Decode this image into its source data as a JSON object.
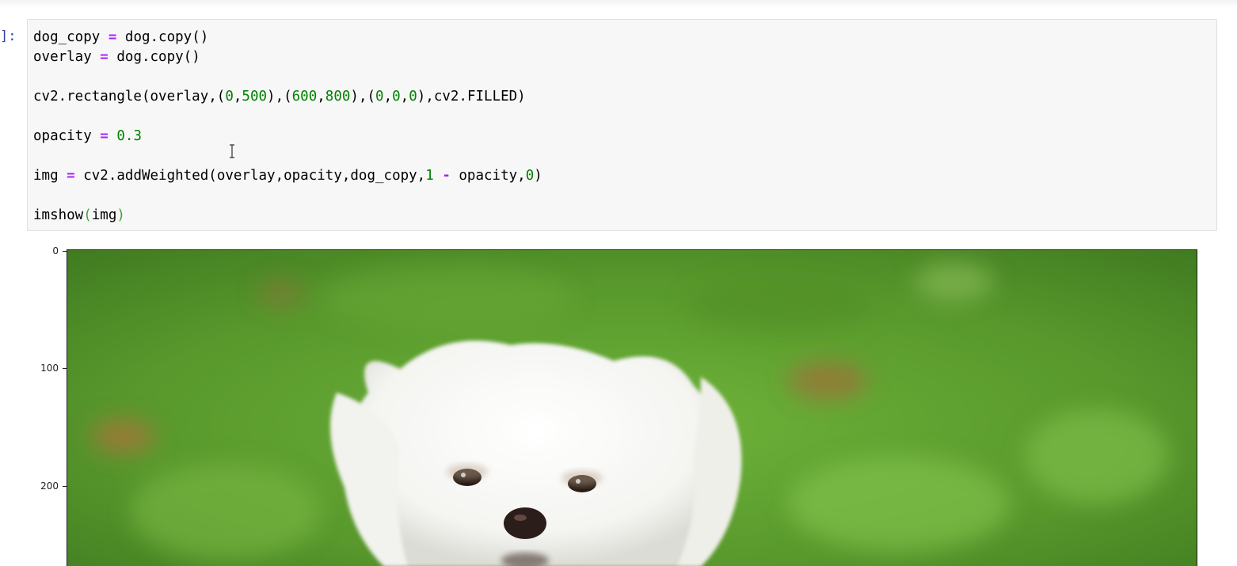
{
  "cell": {
    "prompt": "]:",
    "lines": [
      [
        {
          "t": "dog_copy ",
          "c": ""
        },
        {
          "t": "=",
          "c": "op"
        },
        {
          "t": " dog.copy()",
          "c": ""
        }
      ],
      [
        {
          "t": "overlay ",
          "c": ""
        },
        {
          "t": "=",
          "c": "op"
        },
        {
          "t": " dog.copy()",
          "c": ""
        }
      ],
      [],
      [
        {
          "t": "cv2.rectangle(overlay,(",
          "c": ""
        },
        {
          "t": "0",
          "c": "num"
        },
        {
          "t": ",",
          "c": ""
        },
        {
          "t": "500",
          "c": "num"
        },
        {
          "t": "),(",
          "c": ""
        },
        {
          "t": "600",
          "c": "num"
        },
        {
          "t": ",",
          "c": ""
        },
        {
          "t": "800",
          "c": "num"
        },
        {
          "t": "),(",
          "c": ""
        },
        {
          "t": "0",
          "c": "num"
        },
        {
          "t": ",",
          "c": ""
        },
        {
          "t": "0",
          "c": "num"
        },
        {
          "t": ",",
          "c": ""
        },
        {
          "t": "0",
          "c": "num"
        },
        {
          "t": "),cv2.FILLED)",
          "c": ""
        }
      ],
      [],
      [
        {
          "t": "opacity ",
          "c": ""
        },
        {
          "t": "=",
          "c": "op"
        },
        {
          "t": " ",
          "c": ""
        },
        {
          "t": "0.3",
          "c": "num"
        }
      ],
      [],
      [
        {
          "t": "img ",
          "c": ""
        },
        {
          "t": "=",
          "c": "op"
        },
        {
          "t": " cv2.addWeighted(overlay,opacity,dog_copy,",
          "c": ""
        },
        {
          "t": "1",
          "c": "num"
        },
        {
          "t": " ",
          "c": ""
        },
        {
          "t": "-",
          "c": "op"
        },
        {
          "t": " opacity,",
          "c": ""
        },
        {
          "t": "0",
          "c": "num"
        },
        {
          "t": ")",
          "c": ""
        }
      ],
      [],
      [
        {
          "t": "imshow",
          "c": ""
        },
        {
          "t": "(",
          "c": "paren-g"
        },
        {
          "t": "img",
          "c": ""
        },
        {
          "t": ")",
          "c": "paren-g"
        }
      ]
    ]
  },
  "output": {
    "y_ticks": [
      "0",
      "100",
      "200"
    ],
    "image_description_icon": "dog-photo"
  },
  "colors": {
    "keyword_operator": "#aa22ff",
    "number": "#008000",
    "prompt": "#303f9f",
    "cell_background": "#f7f7f7",
    "grass": "#5a9a2c"
  }
}
